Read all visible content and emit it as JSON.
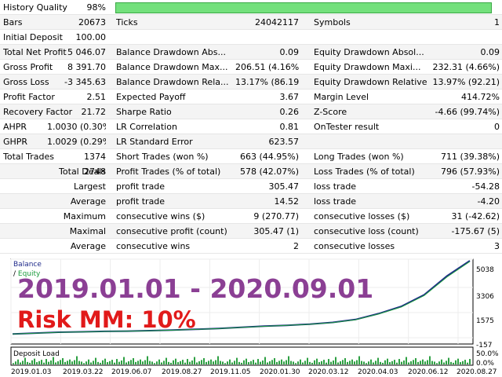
{
  "report": {
    "history_quality": {
      "label": "History Quality",
      "value": "98%",
      "fill_percent": 98
    },
    "rows": [
      [
        "Bars",
        "20673",
        "Ticks",
        "24042117",
        "Symbols",
        "1"
      ],
      [
        "Initial Deposit",
        "100.00",
        "",
        "",
        "",
        ""
      ],
      [
        "Total Net Profit",
        "5 046.07",
        "Balance Drawdown Abs...",
        "0.09",
        "Equity Drawdown Absol...",
        "0.09"
      ],
      [
        "Gross Profit",
        "8 391.70",
        "Balance Drawdown Max...",
        "206.51 (4.16%)",
        "Equity Drawdown Maxi...",
        "232.31 (4.66%)"
      ],
      [
        "Gross Loss",
        "-3 345.63",
        "Balance Drawdown Rela...",
        "13.17% (86.19)",
        "Equity Drawdown Relative",
        "13.97% (92.21)"
      ],
      [
        "Profit Factor",
        "2.51",
        "Expected Payoff",
        "3.67",
        "Margin Level",
        "414.72%"
      ],
      [
        "Recovery Factor",
        "21.72",
        "Sharpe Ratio",
        "0.26",
        "Z-Score",
        "-4.66 (99.74%)"
      ],
      [
        "AHPR",
        "1.0030 (0.30%)",
        "LR Correlation",
        "0.81",
        "OnTester result",
        "0"
      ],
      [
        "GHPR",
        "1.0029 (0.29%)",
        "LR Standard Error",
        "623.57",
        "",
        ""
      ],
      [
        "Total Trades",
        "1374",
        "Short Trades (won %)",
        "663 (44.95%)",
        "Long Trades (won %)",
        "711 (39.38%)"
      ],
      [
        "Total Deals",
        "2748",
        "Profit Trades (% of total)",
        "578 (42.07%)",
        "Loss Trades (% of total)",
        "796 (57.93%)"
      ],
      [
        "Largest",
        "",
        "profit trade",
        "305.47",
        "loss trade",
        "-54.28"
      ],
      [
        "Average",
        "",
        "profit trade",
        "14.52",
        "loss trade",
        "-4.20"
      ],
      [
        "Maximum",
        "",
        "consecutive wins ($)",
        "9 (270.77)",
        "consecutive losses ($)",
        "31 (-42.62)"
      ],
      [
        "Maximal",
        "",
        "consecutive profit (count)",
        "305.47 (1)",
        "consecutive loss (count)",
        "-175.67 (5)"
      ],
      [
        "Average",
        "",
        "consecutive wins",
        "2",
        "consecutive losses",
        "3"
      ]
    ]
  },
  "chart": {
    "legend_balance": "Balance",
    "legend_sep": " / ",
    "legend_equity": "Equity",
    "overlay_period": "2019.01.01 - 2020.09.01",
    "overlay_risk": "Risk MM: 10%",
    "deposit_load_label": "Deposit Load",
    "y_labels": [
      "5038",
      "3306",
      "1575",
      "-157"
    ],
    "deposit_y_labels": [
      "50.0%",
      "0.0%"
    ],
    "x_labels": [
      "2019.01.03",
      "2019.03.22",
      "2019.06.07",
      "2019.08.27",
      "2019.11.05",
      "2020.01.30",
      "2020.03.12",
      "2020.04.03",
      "2020.06.12",
      "2020.08.27"
    ],
    "balance_color": "#1f2a8a",
    "equity_color": "#1a9b3b",
    "deposit_color": "#2ea043",
    "accent_text_color": "#8b3f94",
    "risk_text_color": "#e11a1a"
  },
  "chart_data": {
    "type": "line",
    "series": [
      {
        "name": "Balance",
        "x": [
          0,
          0.05,
          0.1,
          0.15,
          0.2,
          0.25,
          0.3,
          0.35,
          0.4,
          0.45,
          0.5,
          0.55,
          0.6,
          0.65,
          0.7,
          0.75,
          0.8,
          0.85,
          0.9,
          0.95,
          1.0
        ],
        "values": [
          100,
          160,
          220,
          250,
          280,
          300,
          330,
          370,
          420,
          480,
          560,
          640,
          700,
          780,
          900,
          1100,
          1500,
          2000,
          2800,
          4100,
          5146
        ]
      },
      {
        "name": "Equity",
        "x": [
          0,
          0.05,
          0.1,
          0.15,
          0.2,
          0.25,
          0.3,
          0.35,
          0.4,
          0.45,
          0.5,
          0.55,
          0.6,
          0.65,
          0.7,
          0.75,
          0.8,
          0.85,
          0.9,
          0.95,
          1.0
        ],
        "values": [
          100,
          155,
          215,
          245,
          275,
          295,
          325,
          365,
          415,
          470,
          550,
          630,
          690,
          770,
          890,
          1080,
          1470,
          1960,
          2750,
          4030,
          5100
        ]
      }
    ],
    "ylim": [
      -157,
      5038
    ],
    "deposit_load": [
      8,
      18,
      30,
      12,
      22,
      40,
      15,
      10,
      25,
      35,
      14,
      20,
      28,
      11,
      33,
      16,
      24,
      45,
      12,
      19,
      27,
      38,
      15,
      22,
      30,
      18,
      26,
      50,
      21,
      17
    ]
  }
}
